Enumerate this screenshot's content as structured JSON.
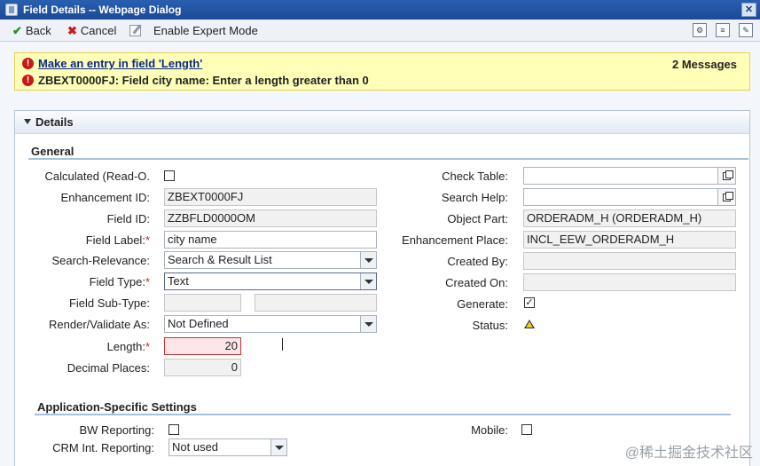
{
  "window": {
    "title": "Field Details -- Webpage Dialog",
    "close_label": "✕"
  },
  "toolbar": {
    "back_label": "Back",
    "cancel_label": "Cancel",
    "expert_label": "Enable Expert Mode",
    "right_icons": [
      "personalize-icon",
      "notes-icon",
      "settings-icon"
    ]
  },
  "messages": {
    "count_label": "2 Messages",
    "items": [
      {
        "text": "Make an entry in field 'Length'",
        "is_link": true
      },
      {
        "text": "ZBEXT0000FJ: Field city name: Enter a length greater than 0",
        "is_link": false
      }
    ]
  },
  "details": {
    "title": "Details",
    "general_title": "General",
    "left": {
      "calculated": {
        "label": "Calculated (Read-O.",
        "checked": false
      },
      "enhancement_id": {
        "label": "Enhancement ID:",
        "value": "ZBEXT0000FJ"
      },
      "field_id": {
        "label": "Field ID:",
        "value": "ZZBFLD0000OM"
      },
      "field_label": {
        "label": "Field Label:",
        "value": "city name",
        "required_mark": "*"
      },
      "search_relevance": {
        "label": "Search-Relevance:",
        "value": "Search & Result List"
      },
      "field_type": {
        "label": "Field Type:",
        "value": "Text",
        "required_mark": "*"
      },
      "field_sub_type": {
        "label": "Field Sub-Type:",
        "value_a": "",
        "value_b": ""
      },
      "render_validate": {
        "label": "Render/Validate As:",
        "value": "Not Defined"
      },
      "length": {
        "label": "Length:",
        "value": "20",
        "required_mark": "*"
      },
      "decimal_places": {
        "label": "Decimal Places:",
        "value": "0"
      }
    },
    "right": {
      "check_table": {
        "label": "Check Table:",
        "value": ""
      },
      "search_help": {
        "label": "Search Help:",
        "value": ""
      },
      "object_part": {
        "label": "Object Part:",
        "value": "ORDERADM_H (ORDERADM_H)"
      },
      "enhancement_place": {
        "label": "Enhancement Place:",
        "value": "INCL_EEW_ORDERADM_H"
      },
      "created_by": {
        "label": "Created By:",
        "value": ""
      },
      "created_on": {
        "label": "Created On:",
        "value": ""
      },
      "generate": {
        "label": "Generate:",
        "checked": true,
        "check_mark": "✓"
      },
      "status": {
        "label": "Status:",
        "icon": "warning-triangle-icon"
      }
    },
    "app_settings": {
      "title": "Application-Specific Settings",
      "bw_reporting": {
        "label": "BW Reporting:",
        "checked": false
      },
      "mobile": {
        "label": "Mobile:",
        "checked": false
      },
      "crm_int_reporting": {
        "label": "CRM Int. Reporting:",
        "value": "Not used"
      }
    }
  },
  "watermark": "@稀土掘金技术社区",
  "colors": {
    "accent": "#1b4a96",
    "message_bg": "#ffffb8",
    "error": "#c81818",
    "error_field_bg": "#fde6ea"
  }
}
